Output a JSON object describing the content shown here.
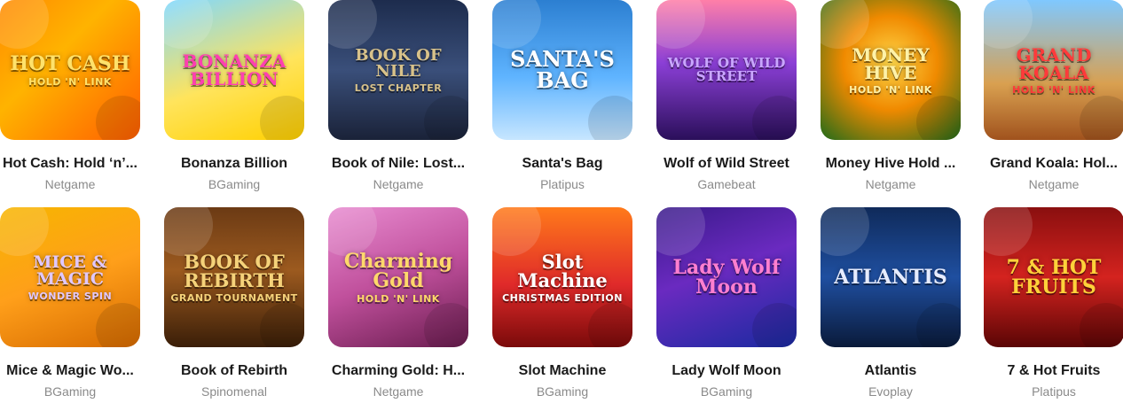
{
  "games": [
    {
      "title": "Hot Cash: Hold ‘n’...",
      "provider": "Netgame",
      "art_line1": "HOT CASH",
      "art_line2": "HOLD 'N' LINK",
      "bg": "linear-gradient(135deg,#ff8a00 0%,#ffb300 40%,#ff5e00 100%)",
      "fg": "#ffe26b",
      "size": 22
    },
    {
      "title": "Bonanza Billion",
      "provider": "BGaming",
      "art_line1": "BONANZA BILLION",
      "art_line2": "",
      "bg": "linear-gradient(160deg,#7fd8ff 0%,#ffe45c 55%,#ffd000 100%)",
      "fg": "#ff3fb1",
      "size": 20
    },
    {
      "title": "Book of Nile: Lost...",
      "provider": "Netgame",
      "art_line1": "BOOK OF NILE",
      "art_line2": "LOST CHAPTER",
      "bg": "linear-gradient(180deg,#1d2c4d 0%,#3a4f7a 50%,#1a2238 100%)",
      "fg": "#d8c28a",
      "size": 18
    },
    {
      "title": "Santa's Bag",
      "provider": "Platipus",
      "art_line1": "SANTA'S BAG",
      "art_line2": "",
      "bg": "linear-gradient(180deg,#2c7fd1 0%,#5fb4ff 55%,#c7e6ff 100%)",
      "fg": "#ffffff",
      "size": 24
    },
    {
      "title": "Wolf of Wild Street",
      "provider": "Gamebeat",
      "art_line1": "WOLF OF WILD STREET",
      "art_line2": "",
      "bg": "linear-gradient(180deg,#ff7fa8 0%,#8b3fd6 45%,#2a0f5a 100%)",
      "fg": "#c9a6ff",
      "size": 15
    },
    {
      "title": "Money Hive Hold ...",
      "provider": "Netgame",
      "art_line1": "MONEY HIVE",
      "art_line2": "HOLD 'N' LINK",
      "bg": "radial-gradient(circle at 50% 45%,#ffd84a 0%,#f08a00 45%,#1f6b1a 100%)",
      "fg": "#fff2a8",
      "size": 20
    },
    {
      "title": "Grand Koala: Hol...",
      "provider": "Netgame",
      "art_line1": "GRAND KOALA",
      "art_line2": "HOLD 'N' LINK",
      "bg": "linear-gradient(180deg,#7fc8ff 0%,#d9a050 60%,#a0521d 100%)",
      "fg": "#ff3a3a",
      "size": 20
    },
    {
      "title": "Mice & Magic Wo...",
      "provider": "BGaming",
      "art_line1": "MICE & MAGIC",
      "art_line2": "WONDER SPIN",
      "bg": "linear-gradient(160deg,#f7b500 0%,#ff9f1a 50%,#d66a00 100%)",
      "fg": "#e0c8ff",
      "size": 19
    },
    {
      "title": "Book of Rebirth",
      "provider": "Spinomenal",
      "art_line1": "BOOK OF REBIRTH",
      "art_line2": "GRAND TOURNAMENT",
      "bg": "linear-gradient(180deg,#6b3a14 0%,#9c5a1f 45%,#3a1e08 100%)",
      "fg": "#f5d27a",
      "size": 21
    },
    {
      "title": "Charming Gold: H...",
      "provider": "Netgame",
      "art_line1": "Charming Gold",
      "art_line2": "HOLD 'N' LINK",
      "bg": "linear-gradient(160deg,#e88bd0 0%,#c0509c 50%,#6a1c4f 100%)",
      "fg": "#ffd86b",
      "size": 22
    },
    {
      "title": "Slot Machine",
      "provider": "BGaming",
      "art_line1": "Slot Machine",
      "art_line2": "CHRISTMAS EDITION",
      "bg": "linear-gradient(180deg,#ff7a1a 0%,#e02a2a 55%,#7a0a0a 100%)",
      "fg": "#ffffff",
      "size": 21
    },
    {
      "title": "Lady Wolf Moon",
      "provider": "BGaming",
      "art_line1": "Lady Wolf Moon",
      "art_line2": "",
      "bg": "linear-gradient(160deg,#3a1a8a 0%,#6a2ac0 45%,#1a2aa0 100%)",
      "fg": "#ff7fd0",
      "size": 22
    },
    {
      "title": "Atlantis",
      "provider": "Evoplay",
      "art_line1": "ATLANTIS",
      "art_line2": "",
      "bg": "linear-gradient(180deg,#0f2a5a 0%,#1f4fa0 50%,#0a1a3a 100%)",
      "fg": "#e6ecff",
      "size": 22
    },
    {
      "title": "7 & Hot Fruits",
      "provider": "Platipus",
      "art_line1": "7 & HOT FRUITS",
      "art_line2": "",
      "bg": "linear-gradient(180deg,#8a0f0f 0%,#d4231f 50%,#5a0505 100%)",
      "fg": "#ffd23a",
      "size": 22
    }
  ]
}
